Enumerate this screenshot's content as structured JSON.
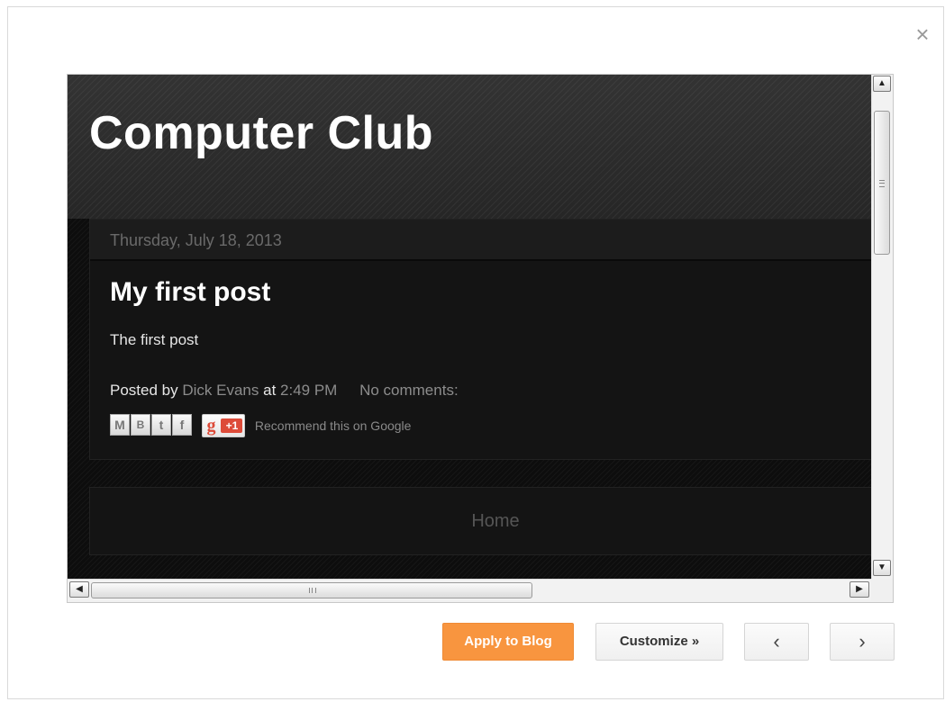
{
  "dialog": {
    "close_icon": "×"
  },
  "preview": {
    "blog_title": "Computer Club",
    "post": {
      "date": "Thursday, July 18, 2013",
      "title": "My first post",
      "body": "The first post",
      "posted_by_label": "Posted by",
      "author": "Dick Evans",
      "at_label": "at",
      "time": "2:49 PM",
      "comments": "No comments:",
      "share": {
        "email_icon": "M",
        "blog_icon": "B",
        "twitter_icon": "t",
        "facebook_icon": "f",
        "gplus_g": "g",
        "gplus_label": "+1",
        "recommend_text": "Recommend this on Google"
      }
    },
    "home_link": "Home"
  },
  "scrollbars": {
    "up_arrow": "▲",
    "down_arrow": "▼",
    "left_arrow": "◀",
    "right_arrow": "▶"
  },
  "actions": {
    "apply_label": "Apply to Blog",
    "customize_label": "Customize »",
    "prev_label": "‹",
    "next_label": "›"
  },
  "colors": {
    "apply_accent": "#f8953f",
    "blog_background": "#0d0d0d"
  }
}
